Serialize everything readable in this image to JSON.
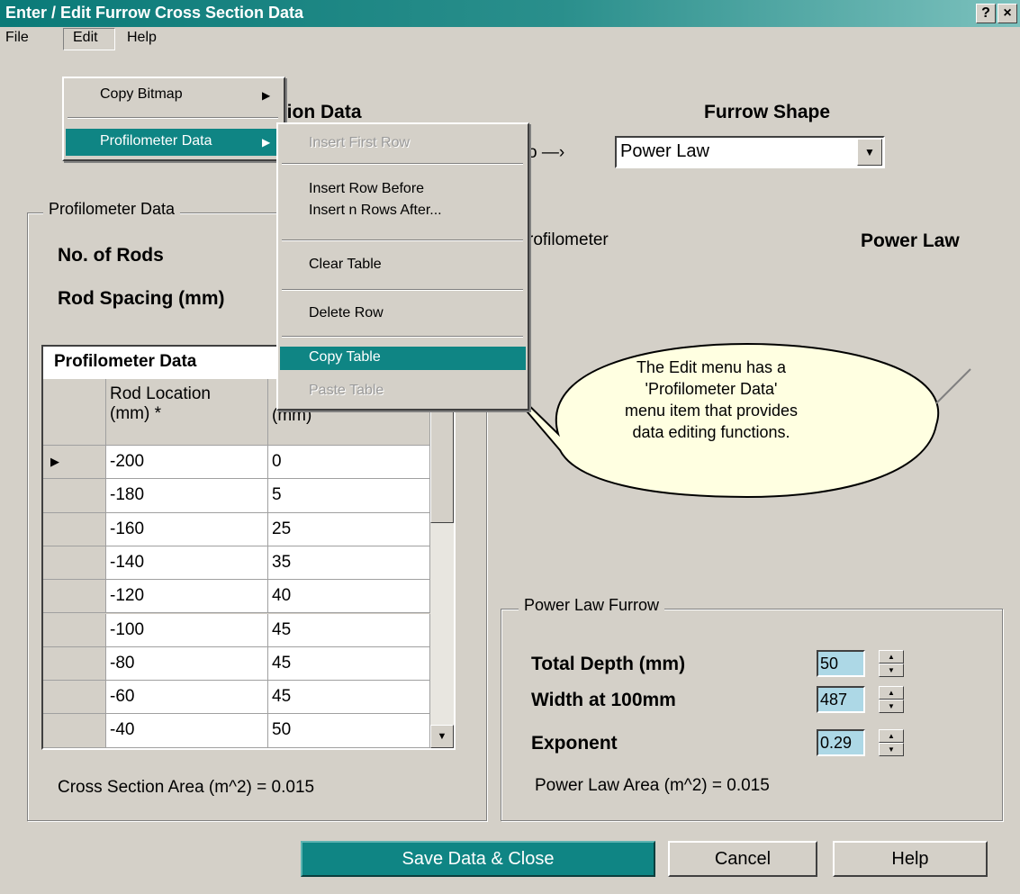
{
  "window": {
    "title": "Enter / Edit Furrow Cross Section Data",
    "help_btn": "?",
    "close_btn": "×"
  },
  "menubar": {
    "file": "File",
    "edit": "Edit",
    "help": "Help"
  },
  "edit_menu": {
    "copy_bitmap": "Copy Bitmap",
    "profilometer_data": "Profilometer Data"
  },
  "submenu": {
    "insert_first_row": "Insert First Row",
    "insert_row_before": "Insert Row Before",
    "insert_n_rows_after": "Insert n Rows After...",
    "clear_table": "Clear Table",
    "delete_row": "Delete Row",
    "copy_table": "Copy Table",
    "paste_table": "Paste Table"
  },
  "header": {
    "section_title_partial": "ction Data",
    "furrow_shape_label": "Furrow Shape",
    "arrow_partial": "o —›"
  },
  "furrow_shape": {
    "selected": "Power Law"
  },
  "profilometer_group": {
    "legend": "Profilometer Data",
    "no_of_rods_label": "No. of Rods",
    "rod_spacing_label": "Rod Spacing (mm)",
    "cross_section_area": "Cross Section Area (m^2) = 0.015"
  },
  "table": {
    "title": "Profilometer Data",
    "col1_header": [
      "Rod Location",
      "(mm) *"
    ],
    "col2_header": "(mm)",
    "rows": [
      [
        "-200",
        "0"
      ],
      [
        "-180",
        "5"
      ],
      [
        "-160",
        "25"
      ],
      [
        "-140",
        "35"
      ],
      [
        "-120",
        "40"
      ],
      [
        "-100",
        "45"
      ],
      [
        "-80",
        "45"
      ],
      [
        "-60",
        "45"
      ],
      [
        "-40",
        "50"
      ]
    ],
    "current_row_marker": "▶"
  },
  "legend_labels": {
    "profilometer": "rofilometer",
    "power_law": "Power Law"
  },
  "callout": {
    "lines": [
      "The Edit menu has a",
      "'Profilometer Data'",
      "menu item that provides",
      "data editing functions."
    ]
  },
  "power_law_group": {
    "legend": "Power Law Furrow",
    "total_depth_label": "Total Depth (mm)",
    "total_depth_value": "50",
    "width_label": "Width at 100mm",
    "width_value": "487",
    "exponent_label": "Exponent",
    "exponent_value": "0.29",
    "area": "Power Law Area (m^2) = 0.015"
  },
  "buttons": {
    "save": "Save Data & Close",
    "cancel": "Cancel",
    "help": "Help"
  },
  "colors": {
    "title_bar": "#0a7a78",
    "highlight": "#0f8584",
    "spinner_bg": "#add8e6",
    "dialog_bg": "#d4d0c8"
  }
}
